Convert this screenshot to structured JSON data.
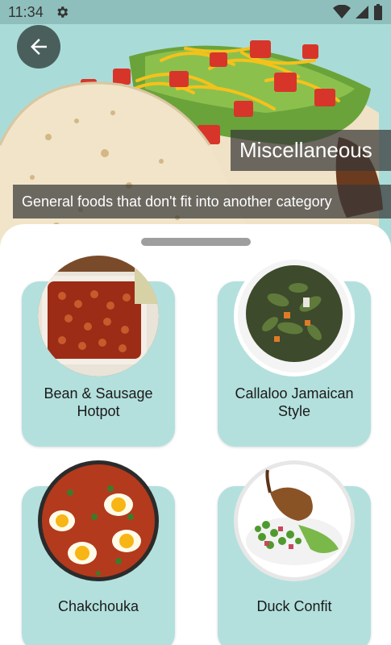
{
  "status_bar": {
    "time": "11:34"
  },
  "header": {
    "title": "Miscellaneous",
    "description": "General foods that don't fit into another category"
  },
  "recipes": [
    {
      "name": "Bean & Sausage Hotpot"
    },
    {
      "name": "Callaloo Jamaican Style"
    },
    {
      "name": "Chakchouka"
    },
    {
      "name": "Duck Confit"
    }
  ],
  "colors": {
    "accent": "#b3e0dd",
    "status_bar": "#8fbfbc",
    "back_button": "#4a5f5c"
  }
}
